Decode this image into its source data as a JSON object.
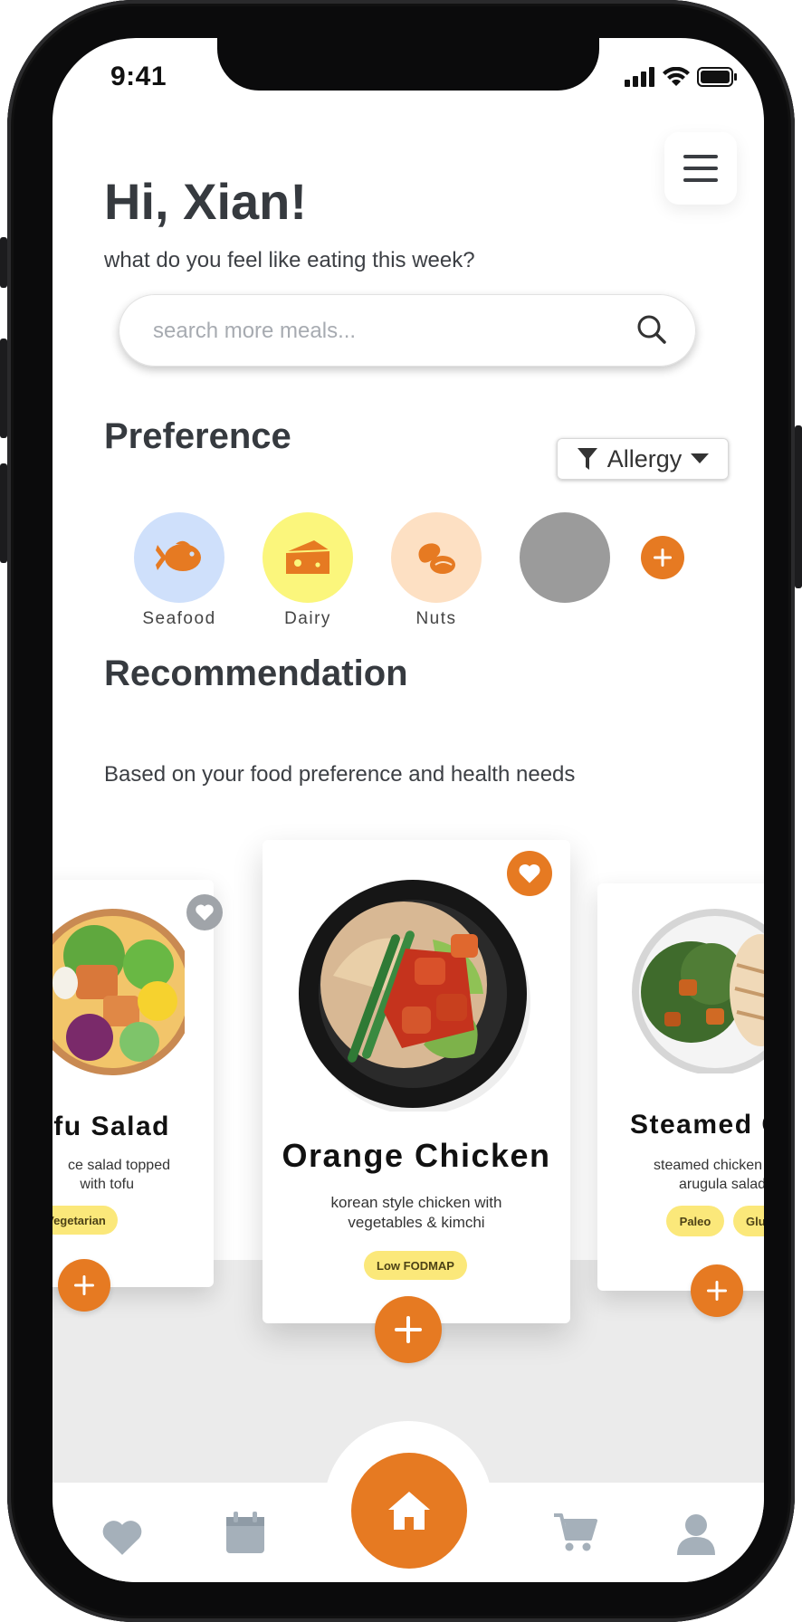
{
  "status": {
    "time": "9:41"
  },
  "header": {
    "greeting": "Hi, Xian!",
    "subtitle": "what do you feel like eating this week?"
  },
  "search": {
    "placeholder": "search more meals..."
  },
  "preference": {
    "title": "Preference",
    "filter_label": "Allergy",
    "items": [
      {
        "label": "Seafood",
        "icon": "fish-icon",
        "color": "#cfe0fb"
      },
      {
        "label": "Dairy",
        "icon": "cheese-icon",
        "color": "#fbf67c"
      },
      {
        "label": "Nuts",
        "icon": "nuts-icon",
        "color": "#fde0c3"
      },
      {
        "label": "",
        "icon": "placeholder",
        "color": "#9b9b9b"
      }
    ]
  },
  "recommendation": {
    "title": "Recommendation",
    "subtitle": "Based on your food preference and health needs",
    "cards": [
      {
        "title": "ofu Salad",
        "desc_line1": "ce salad topped",
        "desc_line2": "with tofu",
        "tags": [
          "Vegetarian"
        ],
        "favorite": false
      },
      {
        "title": "Orange Chicken",
        "desc_line1": "korean style chicken with",
        "desc_line2": "vegetables & kimchi",
        "tags": [
          "Low FODMAP"
        ],
        "favorite": true
      },
      {
        "title": "Steamed C",
        "desc_line1": "steamed chicken w",
        "desc_line2": "arugula salad",
        "tags": [
          "Paleo",
          "Glute"
        ],
        "favorite": false
      }
    ]
  },
  "nav": {
    "items": [
      "heart-icon",
      "calendar-icon",
      "home-icon",
      "cart-icon",
      "profile-icon"
    ]
  },
  "colors": {
    "accent": "#e67a22",
    "text": "#363a3f",
    "tag": "#fbe87a",
    "nav_icon": "#a5b0ba"
  }
}
